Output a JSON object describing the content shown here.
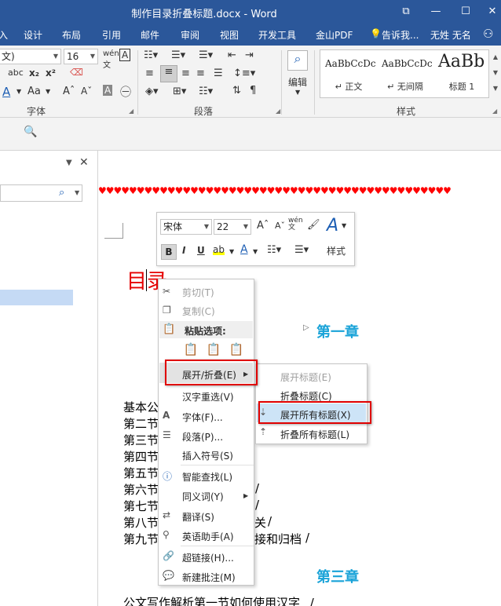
{
  "titlebar": {
    "title": "制作目录折叠标题.docx - Word",
    "restore_icon": "⧉",
    "minimize_icon": "—",
    "maximize_icon": "☐",
    "close_icon": "✕"
  },
  "tabs": [
    "设计",
    "布局",
    "引用",
    "邮件",
    "审阅",
    "视图",
    "开发工具",
    "金山PDF"
  ],
  "tellme": "告诉我...",
  "username": "无姓 无名",
  "ribbon": {
    "font_name": "文)",
    "font_size": "16",
    "font_group_label": "字体",
    "paragraph_group_label": "段落",
    "edit_label": "编辑",
    "styles_group_label": "样式",
    "styles": [
      {
        "sample": "AaBbCcDc",
        "name": "↵ 正文"
      },
      {
        "sample": "AaBbCcDc",
        "name": "↵ 无间隔"
      },
      {
        "sample": "AaBb",
        "name": "标题 1"
      }
    ]
  },
  "mini_toolbar": {
    "font": "宋体",
    "size": "22",
    "style_label": "样式"
  },
  "document": {
    "hearts": "♥♥♥♥♥♥♥♥♥♥♥♥♥♥♥♥♥♥♥♥♥♥♥♥♥♥♥♥♥♥♥♥♥♥♥♥♥♥♥♥♥♥♥♥♥♥",
    "toc_title": "目录",
    "chapter1": "第一章",
    "chapter3": "第三章",
    "lines": [
      "基本公",
      "第二节",
      "第三节",
      "第四节",
      "第五节",
      "第六节",
      "第七节",
      "第八节",
      "第九节"
    ],
    "line8_tail": "关",
    "line9_tail": "接和归档",
    "bottom_line": "公文写作解析第一节如何使用汉字",
    "slash": "/"
  },
  "context_menu": {
    "cut": "剪切(T)",
    "copy": "复制(C)",
    "paste_options": "粘贴选项:",
    "expand_collapse": "展开/折叠(E)",
    "reselect": "汉字重选(V)",
    "font": "字体(F)...",
    "paragraph": "段落(P)...",
    "insert_symbol": "插入符号(S)",
    "smart_lookup": "智能查找(L)",
    "synonyms": "同义词(Y)",
    "translate": "翻译(S)",
    "english_assistant": "英语助手(A)",
    "hyperlink": "超链接(H)...",
    "new_comment": "新建批注(M)"
  },
  "submenu": {
    "expand_heading": "展开标题(E)",
    "collapse_heading": "折叠标题(C)",
    "expand_all": "展开所有标题(X)",
    "collapse_all": "折叠所有标题(L)"
  }
}
